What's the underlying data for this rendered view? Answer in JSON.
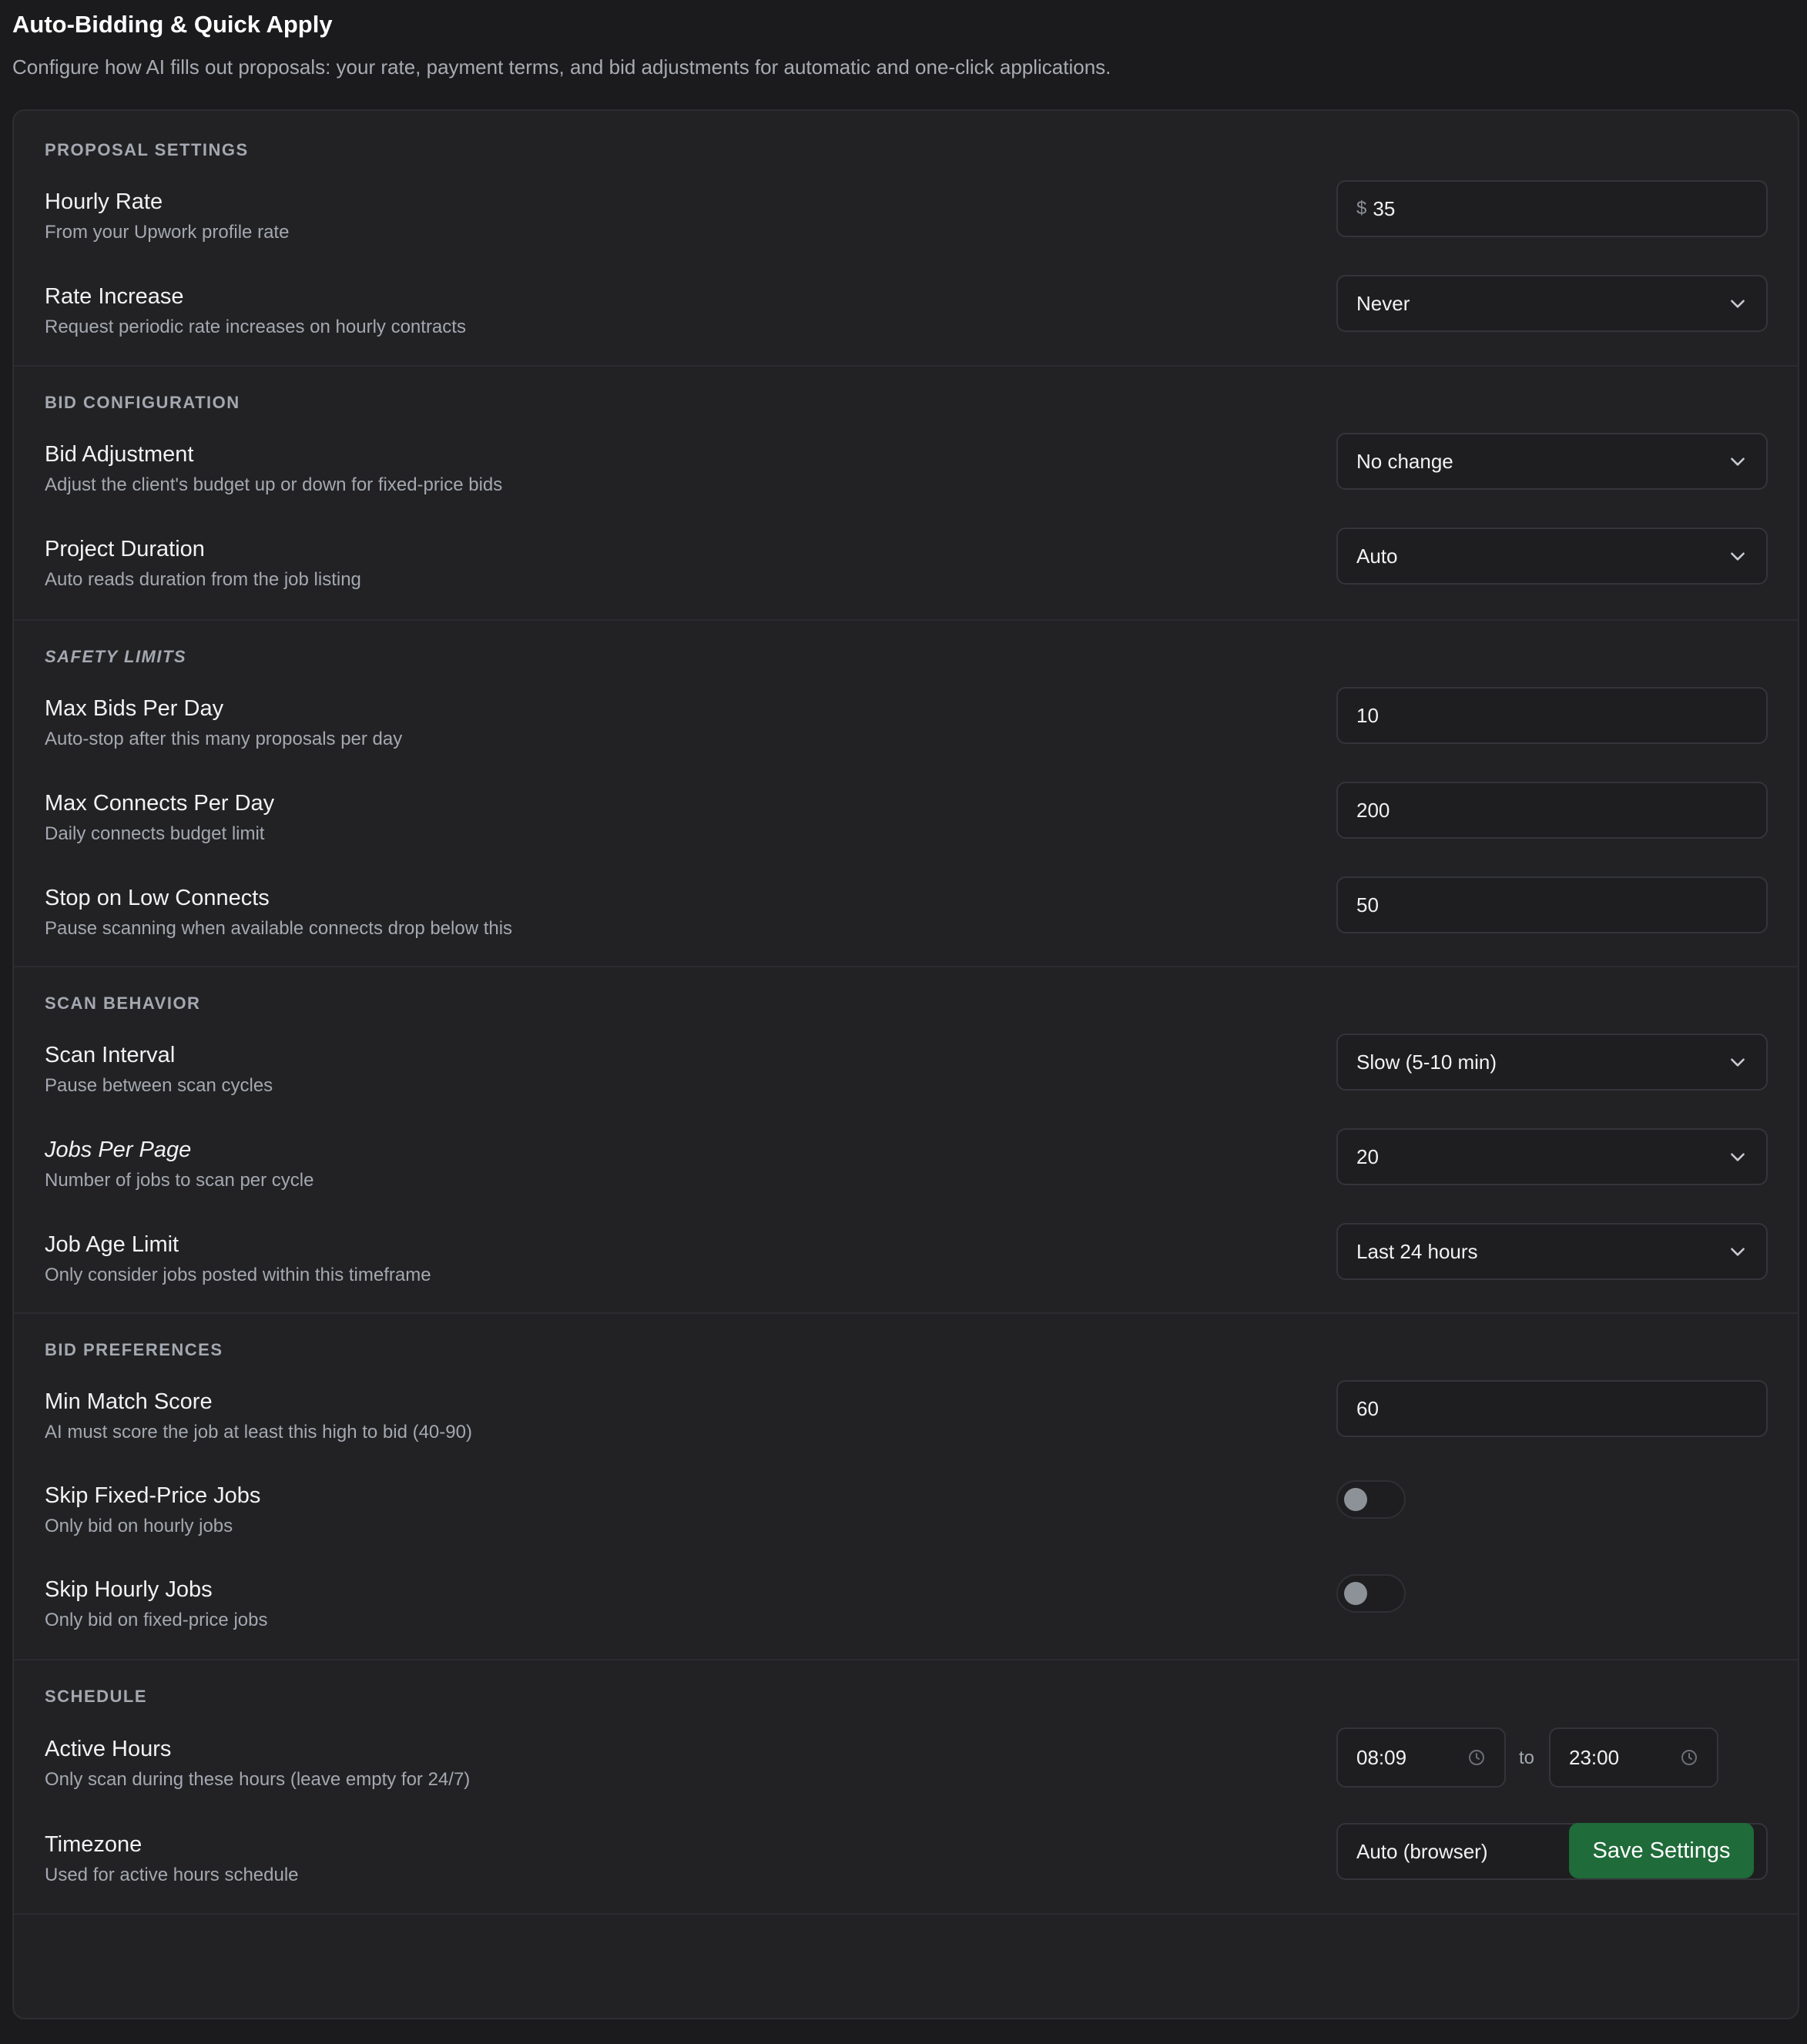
{
  "header": {
    "title": "Auto-Bidding & Quick Apply",
    "description": "Configure how AI fills out proposals: your rate, payment terms, and bid adjustments for automatic and one-click applications."
  },
  "sections": {
    "proposal": {
      "title": "PROPOSAL SETTINGS",
      "hourly_rate": {
        "label": "Hourly Rate",
        "description": "From your Upwork profile rate",
        "prefix": "$",
        "value": "35"
      },
      "rate_increase": {
        "label": "Rate Increase",
        "description": "Request periodic rate increases on hourly contracts",
        "value": "Never"
      }
    },
    "bid_config": {
      "title": "BID CONFIGURATION",
      "bid_adjustment": {
        "label": "Bid Adjustment",
        "description": "Adjust the client's budget up or down for fixed-price bids",
        "value": "No change"
      },
      "project_duration": {
        "label": "Project Duration",
        "description": "Auto reads duration from the job listing",
        "value": "Auto"
      }
    },
    "safety": {
      "title": "SAFETY LIMITS",
      "max_bids": {
        "label": "Max Bids Per Day",
        "description": "Auto-stop after this many proposals per day",
        "value": "10"
      },
      "max_connects": {
        "label": "Max Connects Per Day",
        "description": "Daily connects budget limit",
        "value": "200"
      },
      "stop_low": {
        "label": "Stop on Low Connects",
        "description": "Pause scanning when available connects drop below this",
        "value": "50"
      }
    },
    "scan": {
      "title": "SCAN BEHAVIOR",
      "scan_interval": {
        "label": "Scan Interval",
        "description": "Pause between scan cycles",
        "value": "Slow (5-10 min)"
      },
      "jobs_per_page": {
        "label": "Jobs Per Page",
        "description": "Number of jobs to scan per cycle",
        "value": "20"
      },
      "job_age": {
        "label": "Job Age Limit",
        "description": "Only consider jobs posted within this timeframe",
        "value": "Last 24 hours"
      }
    },
    "bid_prefs": {
      "title": "BID PREFERENCES",
      "min_match": {
        "label": "Min Match Score",
        "description": "AI must score the job at least this high to bid (40-90)",
        "value": "60"
      },
      "skip_fixed": {
        "label": "Skip Fixed-Price Jobs",
        "description": "Only bid on hourly jobs",
        "enabled": false
      },
      "skip_hourly": {
        "label": "Skip Hourly Jobs",
        "description": "Only bid on fixed-price jobs",
        "enabled": false
      }
    },
    "schedule": {
      "title": "SCHEDULE",
      "active_hours": {
        "label": "Active Hours",
        "description": "Only scan during these hours (leave empty for 24/7)",
        "start": "08:09",
        "separator": "to",
        "end": "23:00"
      },
      "timezone": {
        "label": "Timezone",
        "description": "Used for active hours schedule",
        "value": "Auto (browser)"
      }
    }
  },
  "actions": {
    "save_label": "Save Settings"
  },
  "colors": {
    "background": "#1b1b1d",
    "card": "#222224",
    "accent": "#1f6b3a",
    "muted": "#a4a8b1"
  },
  "icons": [
    "chevron-down-icon",
    "clock-icon"
  ]
}
